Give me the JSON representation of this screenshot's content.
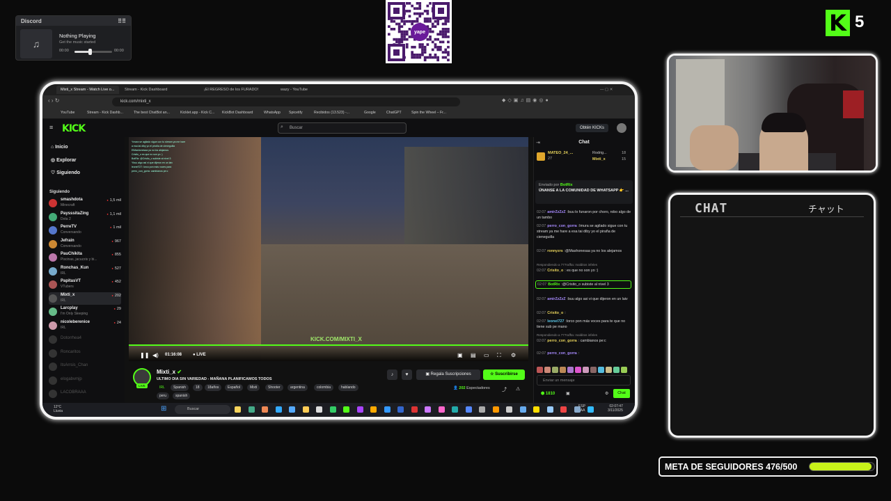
{
  "discord": {
    "header": "Discord",
    "grip": "⠿⠿",
    "now_playing": "Nothing Playing",
    "subtitle": "Get the music started",
    "time_start": "00:00",
    "time_end": "00:00",
    "progress": 0.4
  },
  "qr": {
    "logo_text": "yape"
  },
  "kick_badge": {
    "letter": "K",
    "count": "5"
  },
  "browser": {
    "tabs": [
      "Mixti_x Stream - Watch Live o...",
      "Stream - Kick Dashboard",
      "¡El REGRESO de los FURADO!",
      "wazy - YouTube"
    ],
    "url": "kick.com/mixti_x",
    "bookmarks": [
      "YouTube",
      "Stream - Kick Dashb...",
      "The best ChatBot an...",
      "Kicklet.app - Kick C...",
      "KickBot Dashboard",
      "WhatsApp",
      "Spicetify",
      "Recibidos (13.523) -...",
      "Google",
      "ChatGPT",
      "Spin the Wheel – Fr..."
    ]
  },
  "kick": {
    "logo": "KICK",
    "search_placeholder": "Buscar",
    "get_kicks": "Obtén KICKs",
    "nav": [
      "Inicio",
      "Explorar",
      "Siguiendo"
    ],
    "following_header": "Siguiendo",
    "following": [
      {
        "name": "smashdota",
        "sub": "Minecraft",
        "viewers": "1,5 mil"
      },
      {
        "name": "PaysssitaZing",
        "sub": "Dota 2",
        "viewers": "1,1 mil"
      },
      {
        "name": "PerreTV",
        "sub": "Conversando",
        "viewers": "1 mil"
      },
      {
        "name": "Jefrain",
        "sub": "Conversando",
        "viewers": "967"
      },
      {
        "name": "PauChikita",
        "sub": "Piscinas, jacuzzis y bi...",
        "viewers": "855"
      },
      {
        "name": "Ronchas_Kun",
        "sub": "IRL",
        "viewers": "527"
      },
      {
        "name": "PapitasVT",
        "sub": "VTubers",
        "viewers": "452"
      },
      {
        "name": "Mixti_x",
        "sub": "IRL",
        "viewers": "202"
      },
      {
        "name": "Larcplay",
        "sub": "I'm Only Sleeping",
        "viewers": "29"
      },
      {
        "name": "nicoleberenice",
        "sub": "IRL",
        "viewers": "24"
      }
    ],
    "offline": [
      "Dotorrhea4",
      "Roncaritos",
      "ItsArrsis_Chan",
      "elogabvmjp",
      "LACOBRAAA"
    ],
    "video": {
      "watermark": "KICK.COM/MIXTI_X",
      "time": "01:16:08",
      "live": "LIVE",
      "overlay_chat": [
        "Ymara se agilado sigue con tu stream ya me hare",
        "a esa tai diby yo el piraña de cieneguilla",
        "ElMashonesaa ya no los alejamos",
        "Crisito_o es que no son yo :)",
        "BotRix: @Crisito_o subiste al nivel 3",
        "Ybuu algo asi vi que dijeron en un laiv",
        "leonel727: lorco pon más voces para",
        "perro_con_gorra: cambianos pe:c"
      ]
    },
    "streamer": {
      "name": "Mixti_x",
      "live_badge": "LIVE",
      "title": "ULTIMO DIA SIN VARIEDAD - MAÑANA PLANIFICAMOS TODOS",
      "tags": [
        "IRL",
        "Spanish",
        "18",
        "18años",
        "Español",
        "Mixti",
        "Shooter",
        "argentina",
        "colombia",
        "hablando",
        "peru",
        "spanish"
      ],
      "gift_subs": "Regala Suscripciones",
      "subscribe": "Suscribirse",
      "viewers": "202",
      "viewers_label": "Espectadores"
    },
    "chat": {
      "header": "Chat",
      "pinned": [
        {
          "name": "MATEO_24_...",
          "count": "27"
        },
        {
          "name": "Rodrig...",
          "count": "18"
        },
        {
          "name": "Mixti_x",
          "count": "15"
        }
      ],
      "announce_by": "Enviado por",
      "announce_bot": "BotRix",
      "announce_text": "ÚNANSE A LA COMUNIDAD DE WHATSAPP 👉 ...",
      "messages": [
        {
          "time": "02:07",
          "user": "amirZzZzZ",
          "text": ":buu lo funaron por choro, robo algo de un tambo",
          "color": "#a88bff"
        },
        {
          "time": "02:07",
          "user": "perro_con_gorra",
          "text": ":Imura se agilado sigue con tu stream ya me hare a esa tai diby yo el piraña de cieneguilla",
          "color": "#a88bff"
        },
        {
          "time": "02:07",
          "user": "ronnyzrs",
          "text": ":@Mashonesaa ya no los alejamos",
          "color": "#e9d45c"
        },
        {
          "time": "02:07",
          "user": "Crisito_o",
          "text": ": es que no son yo :)",
          "color": "#e9d45c",
          "reply": "Respondiendo a 777raffta: malditos infeles"
        },
        {
          "time": "02:07",
          "user": "BotRix",
          "text": ":@Crisito_o subiste al nivel 3",
          "color": "#53fc18",
          "highlight": true
        },
        {
          "time": "02:07",
          "user": "amirZzZzZ",
          "text": ":buu algo asi vi que dijeron en un laiv",
          "color": "#a88bff"
        },
        {
          "time": "02:07",
          "user": "Crisito_o",
          "text": ":",
          "color": "#e9d45c"
        },
        {
          "time": "02:07",
          "user": "leonel727",
          "text": ":lorco pon más voces para te que no tiene sub pe mano",
          "color": "#5cc8e9"
        },
        {
          "time": "02:07",
          "user": "perro_con_gorra",
          "text": ": cambianos pe:c",
          "color": "#e9d45c",
          "reply": "Respondiendo a 777raffta: malditos infeles"
        },
        {
          "time": "02:07",
          "user": "perro_con_gorra",
          "text": ":",
          "color": "#a88bff"
        }
      ],
      "input_placeholder": "Enviar un mensaje",
      "points": "1810",
      "send": "Chat"
    },
    "taskbar": {
      "search": "Buscar",
      "weather_temp": "12°C",
      "weather_text": "Lluvia",
      "lang1": "ESP",
      "lang2": "LAA",
      "time": "02:07:47",
      "date": "3/11/2025"
    }
  },
  "overlay_chat": {
    "title": "CHAT",
    "title_jp": "チャット"
  },
  "goal": {
    "label": "META DE SEGUIDORES 476/500",
    "current": 476,
    "target": 500
  }
}
